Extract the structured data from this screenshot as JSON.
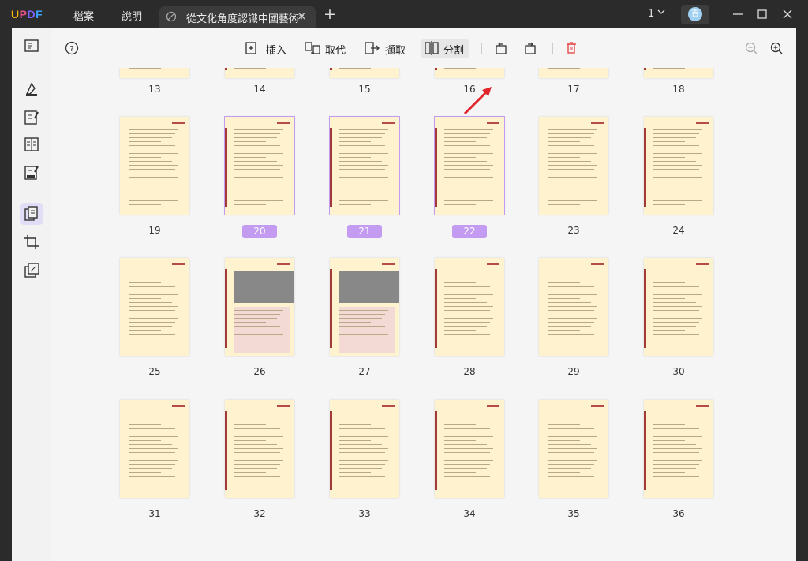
{
  "app": {
    "logo": {
      "u": "U",
      "p": "P",
      "d": "D",
      "f": "F"
    }
  },
  "menu": {
    "file": "檔案",
    "help": "說明"
  },
  "tab": {
    "title": "從文化角度認識中國藝術*",
    "close": "×",
    "add": "+"
  },
  "window": {
    "page_count": "1",
    "avatar_initial": "吉"
  },
  "toolbar": {
    "insert": "插入",
    "replace": "取代",
    "extract": "擷取",
    "split": "分割"
  },
  "accent": "#c39bf0",
  "pages": {
    "row0": [
      "13",
      "14",
      "15",
      "16",
      "17",
      "18"
    ],
    "row1": [
      "19",
      "20",
      "21",
      "22",
      "23",
      "24"
    ],
    "row2": [
      "25",
      "26",
      "27",
      "28",
      "29",
      "30"
    ],
    "row3": [
      "31",
      "32",
      "33",
      "34",
      "35",
      "36"
    ]
  },
  "selected_pages": [
    "20",
    "21",
    "22"
  ]
}
